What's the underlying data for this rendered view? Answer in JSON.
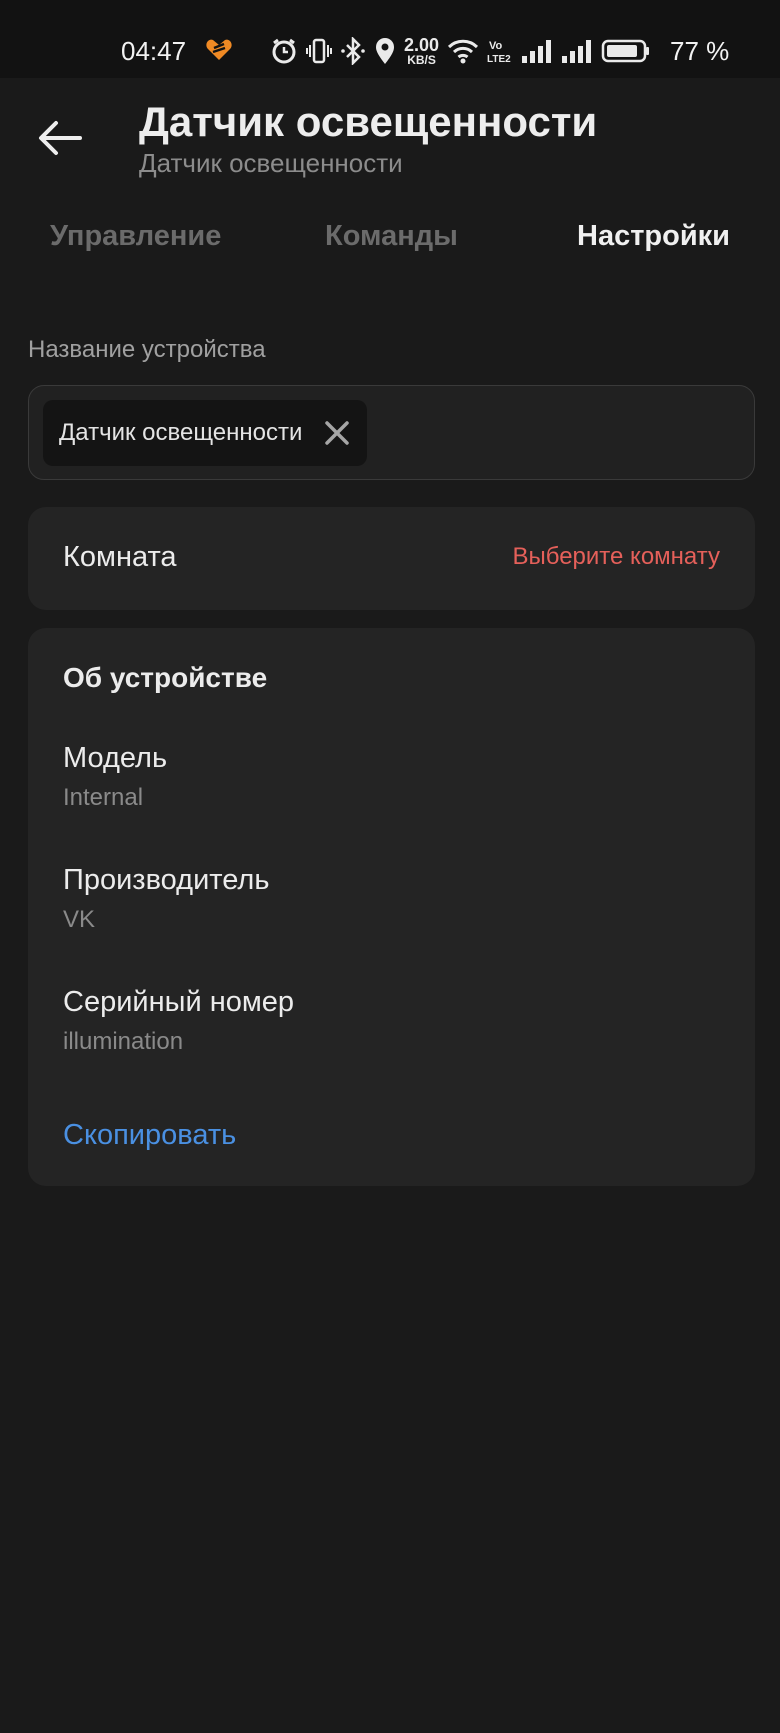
{
  "status_bar": {
    "time": "04:47",
    "speed_value": "2.00",
    "speed_unit": "KB/S",
    "battery_percent": "77 %",
    "icons": [
      "heart-icon",
      "alarm-icon",
      "vibrate-icon",
      "bluetooth-icon",
      "location-icon",
      "wifi-icon",
      "volte-icon",
      "signal-icon",
      "signal-2-icon",
      "battery-icon"
    ]
  },
  "header": {
    "title": "Датчик освещенности",
    "subtitle": "Датчик освещенности"
  },
  "tabs": [
    {
      "label": "Управление",
      "active": false
    },
    {
      "label": "Команды",
      "active": false
    },
    {
      "label": "Настройки",
      "active": true
    }
  ],
  "device_name": {
    "label": "Название устройства",
    "value": "Датчик освещенности"
  },
  "room": {
    "label": "Комната",
    "value": "Выберите комнату"
  },
  "about": {
    "title": "Об устройстве",
    "items": [
      {
        "label": "Модель",
        "value": "Internal"
      },
      {
        "label": "Производитель",
        "value": "VK"
      },
      {
        "label": "Серийный номер",
        "value": "illumination"
      }
    ],
    "copy_label": "Скопировать"
  },
  "colors": {
    "background": "#1a1a1a",
    "card": "#242424",
    "accent_red": "#e5605a",
    "accent_blue": "#4a90e2"
  }
}
